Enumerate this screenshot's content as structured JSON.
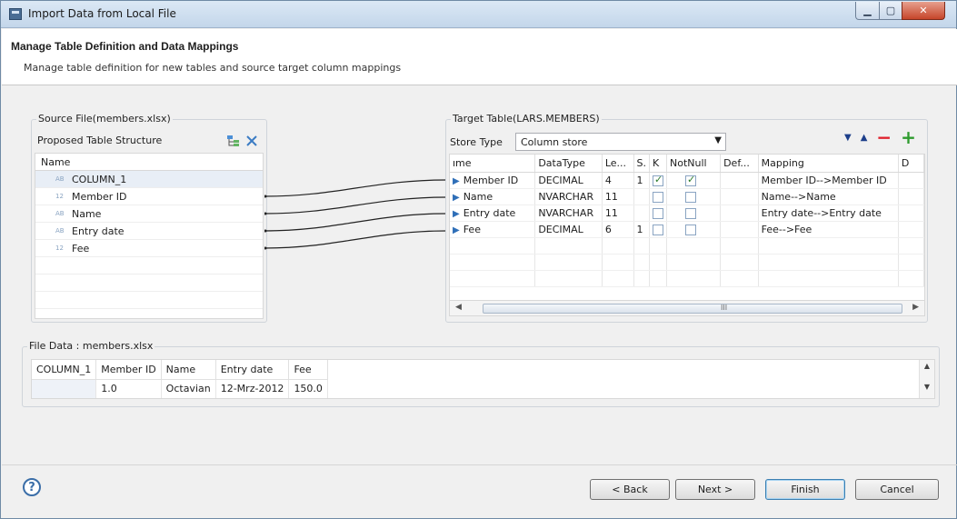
{
  "window": {
    "title": "Import Data from Local File"
  },
  "header": {
    "title": "Manage Table Definition and Data Mappings",
    "subtitle": "Manage table definition for new tables and source target column mappings"
  },
  "source": {
    "group_label": "Source File(members.xlsx)",
    "structure_label": "Proposed Table Structure",
    "column_header": "Name",
    "rows": [
      {
        "tag": "AB",
        "name": "COLUMN_1"
      },
      {
        "tag": "12",
        "name": "Member ID"
      },
      {
        "tag": "AB",
        "name": "Name"
      },
      {
        "tag": "AB",
        "name": "Entry date"
      },
      {
        "tag": "12",
        "name": "Fee"
      }
    ]
  },
  "target": {
    "group_label": "Target Table(LARS.MEMBERS)",
    "store_type_label": "Store Type",
    "store_type_value": "Column store",
    "columns": [
      "ıme",
      "DataType",
      "Le...",
      "S.",
      "K",
      "NotNull",
      "Def...",
      "Mapping",
      "D"
    ],
    "rows": [
      {
        "name": "Member ID",
        "type": "DECIMAL",
        "len": "4",
        "scale": "1",
        "key": true,
        "notnull": true,
        "mapping": "Member ID-->Member ID"
      },
      {
        "name": "Name",
        "type": "NVARCHAR",
        "len": "11",
        "scale": "",
        "key": false,
        "notnull": false,
        "mapping": "Name-->Name"
      },
      {
        "name": "Entry date",
        "type": "NVARCHAR",
        "len": "11",
        "scale": "",
        "key": false,
        "notnull": false,
        "mapping": "Entry date-->Entry date"
      },
      {
        "name": "Fee",
        "type": "DECIMAL",
        "len": "6",
        "scale": "1",
        "key": false,
        "notnull": false,
        "mapping": "Fee-->Fee"
      }
    ],
    "scroll_grip": "III"
  },
  "filedata": {
    "group_label": "File Data : members.xlsx",
    "columns": [
      "COLUMN_1",
      "Member ID",
      "Name",
      "Entry date",
      "Fee"
    ],
    "rows": [
      [
        "",
        "1.0",
        "Octavian",
        "12-Mrz-2012",
        "150.0"
      ]
    ]
  },
  "footer": {
    "help": "?",
    "back": "< Back",
    "next": "Next >",
    "finish": "Finish",
    "cancel": "Cancel"
  },
  "icons": {
    "window": "import-table-icon",
    "move_down": "triangle-down-icon",
    "move_up": "triangle-up-icon",
    "remove": "minus-icon",
    "add": "plus-icon",
    "tree": "tree-structure-icon",
    "delete": "x-icon"
  },
  "colors": {
    "accent": "#2f6fb8",
    "remove": "#e0202c",
    "add": "#2e9b2e"
  }
}
